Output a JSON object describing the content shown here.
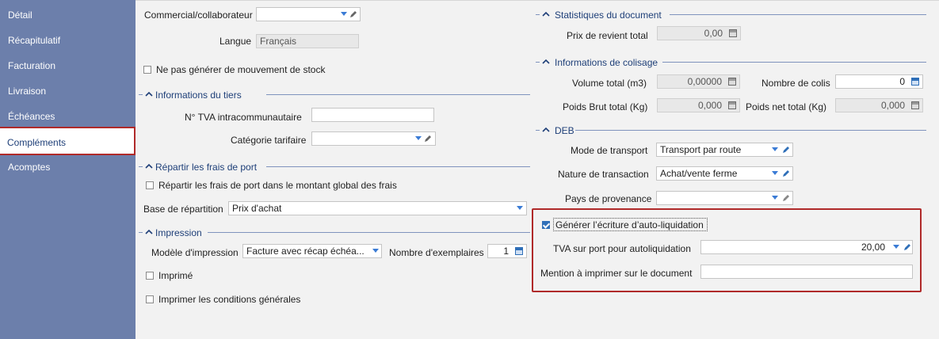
{
  "sidebar": {
    "items": [
      {
        "label": "Détail"
      },
      {
        "label": "Récapitulatif"
      },
      {
        "label": "Facturation"
      },
      {
        "label": "Livraison"
      },
      {
        "label": "Échéances"
      },
      {
        "label": "Compléments"
      },
      {
        "label": "Acomptes"
      }
    ],
    "active_index": 5
  },
  "left": {
    "commercial_label": "Commercial/collaborateur",
    "commercial_value": "",
    "langue_label": "Langue",
    "langue_value": "Français",
    "no_stock_label": "Ne pas générer de mouvement de stock",
    "no_stock_checked": false,
    "tiers_section": "Informations du tiers",
    "tva_label": "N° TVA intracommunautaire",
    "tva_value": "",
    "categorie_label": "Catégorie tarifaire",
    "categorie_value": "",
    "frais_section": "Répartir les frais de port",
    "repartir_label": "Répartir les frais de port dans le montant global des frais",
    "repartir_checked": false,
    "base_label": "Base de répartition",
    "base_value": "Prix d'achat",
    "impression_section": "Impression",
    "modele_label": "Modèle d'impression",
    "modele_value": "Facture avec récap échéa...",
    "exemplaires_label": "Nombre d'exemplaires",
    "exemplaires_value": "1",
    "imprime_label": "Imprimé",
    "imprime_checked": false,
    "conditions_label": "Imprimer les conditions générales",
    "conditions_checked": false
  },
  "right": {
    "stats_section": "Statistiques du document",
    "prix_revient_label": "Prix de revient total",
    "prix_revient_value": "0,00",
    "colisage_section": "Informations de colisage",
    "volume_label": "Volume total (m3)",
    "volume_value": "0,00000",
    "colis_label": "Nombre de colis",
    "colis_value": "0",
    "poids_brut_label": "Poids Brut total (Kg)",
    "poids_brut_value": "0,000",
    "poids_net_label": "Poids net total (Kg)",
    "poids_net_value": "0,000",
    "deb_section": "DEB",
    "transport_label": "Mode de transport",
    "transport_value": "Transport par route",
    "transaction_label": "Nature de transaction",
    "transaction_value": "Achat/vente ferme",
    "provenance_label": "Pays de provenance",
    "provenance_value": "",
    "autoliq_label": "Générer l’écriture d’auto-liquidation",
    "autoliq_checked": true,
    "tva_port_label": "TVA sur port pour autoliquidation",
    "tva_port_value": "20,00",
    "mention_label": "Mention à imprimer sur le document",
    "mention_value": ""
  },
  "colors": {
    "sidebar_bg": "#6c7fab",
    "section_title": "#1e3f78",
    "accent_blue": "#3a7bd5",
    "highlight_red": "#b02a2a"
  }
}
